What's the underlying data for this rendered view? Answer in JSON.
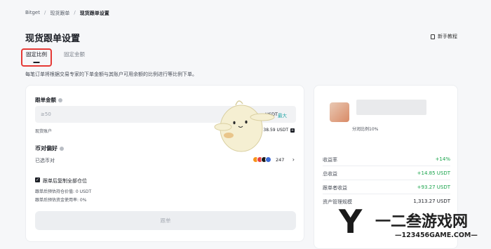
{
  "breadcrumb": [
    "Bitget",
    "现货跟单",
    "现货跟单设置"
  ],
  "page_title": "现货跟单设置",
  "guide_label": "新手教程",
  "tabs": [
    {
      "label": "固定比例",
      "active": true
    },
    {
      "label": "固定金额",
      "active": false
    }
  ],
  "description": "每笔订单将根据交易专家的下单金额与其账户可用余额的比例进行等比例下单。",
  "form": {
    "amount_label": "跟单金额",
    "amount_placeholder": "≥50",
    "amount_unit": "USDT",
    "max_label": "最大",
    "account_label": "现货账户",
    "account_balance": "38.59 USDT",
    "pair_label": "币对偏好",
    "selected_label": "已选币对",
    "pair_count": "247",
    "copy_all_label": "跟单后复制全部仓位",
    "est_position": "跟单后预估持仓价值: 0 USDT",
    "est_usage": "跟单后预估资金使用率: 0%",
    "submit_label": "跟单"
  },
  "trader": {
    "profit_share": "分润比例10%",
    "stats": [
      {
        "key": "收益率",
        "value": "+14%"
      },
      {
        "key": "总收益",
        "value": "+14.85 USDT"
      },
      {
        "key": "跟单者收益",
        "value": "+93.27 USDT"
      }
    ],
    "partial_label": "资产管理规模",
    "partial_value": "1,313.27 USDT"
  },
  "watermark": {
    "logo": "Y",
    "title": "一二叁游戏网",
    "site": "—123456GAME.COM—"
  },
  "colors": {
    "accent": "#1fa5a5",
    "positive": "#17a34a",
    "highlight_border": "#e53935"
  }
}
